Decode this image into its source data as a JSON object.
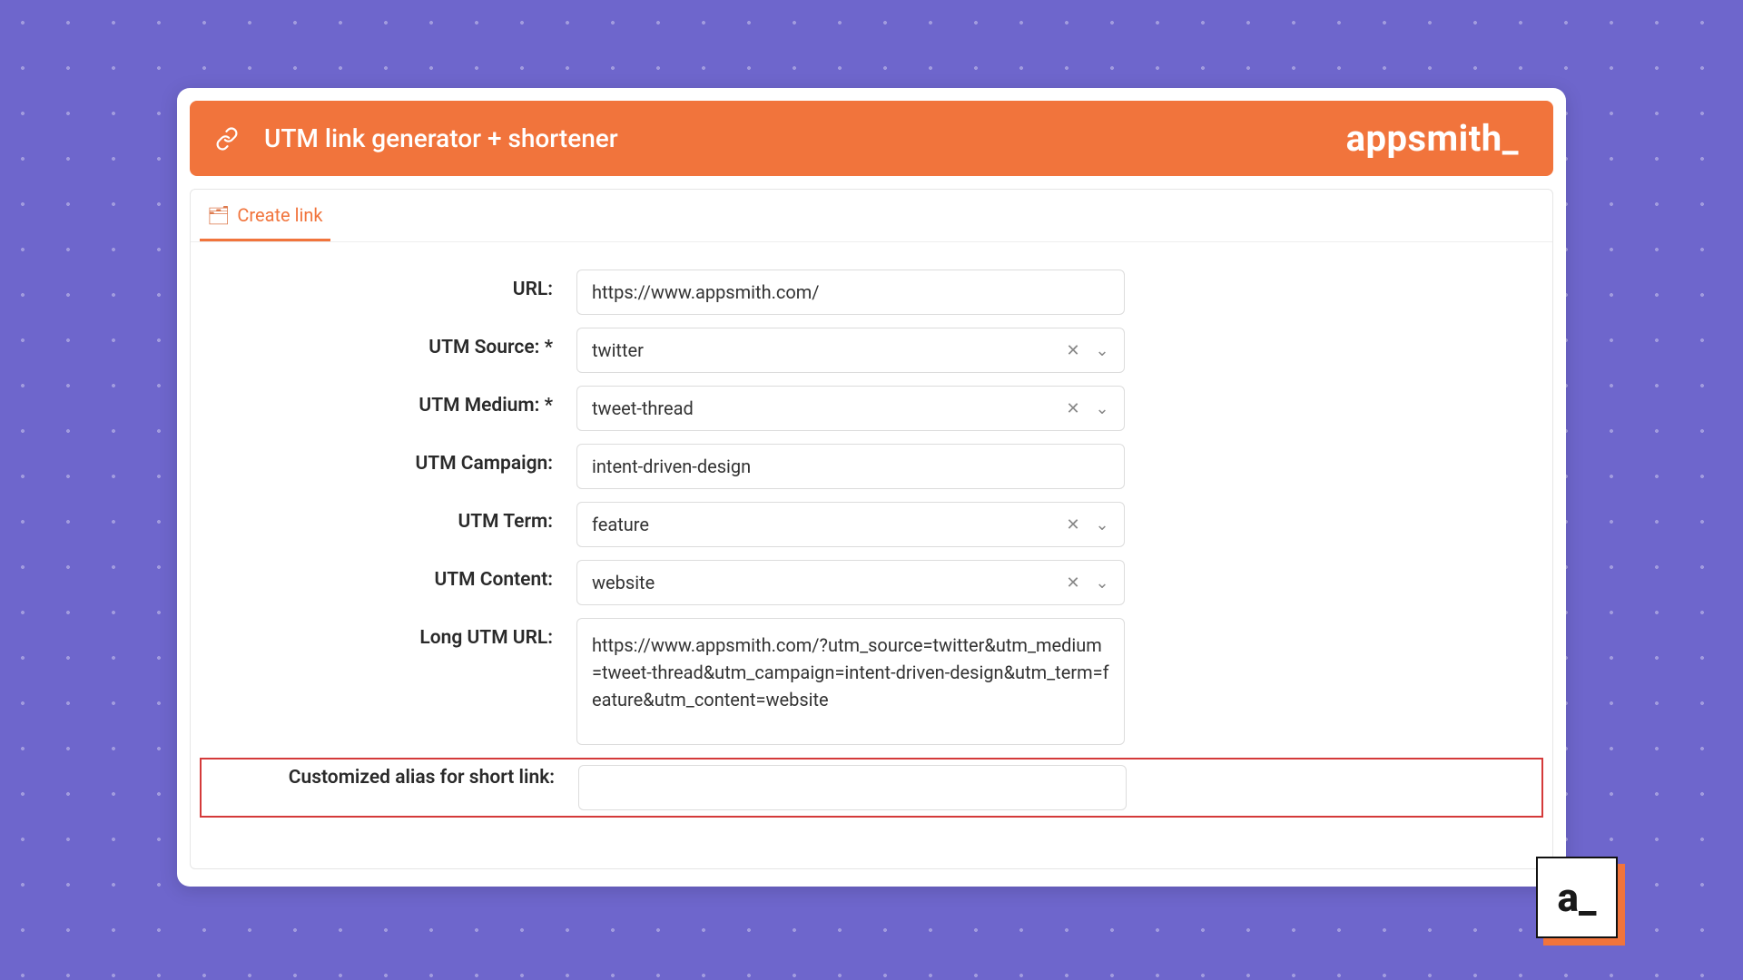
{
  "header": {
    "title": "UTM link generator + shortener",
    "brand": "appsmith_"
  },
  "tabs": {
    "create_link": {
      "icon": "🗂",
      "label": "Create link"
    }
  },
  "form": {
    "url": {
      "label": "URL:",
      "value": "https://www.appsmith.com/"
    },
    "utm_source": {
      "label": "UTM Source: *",
      "value": "twitter"
    },
    "utm_medium": {
      "label": "UTM Medium: *",
      "value": "tweet-thread"
    },
    "utm_campaign": {
      "label": "UTM Campaign:",
      "value": "intent-driven-design"
    },
    "utm_term": {
      "label": "UTM Term:",
      "value": "feature"
    },
    "utm_content": {
      "label": "UTM Content:",
      "value": "website"
    },
    "long_url": {
      "label": "Long UTM URL:",
      "value": "https://www.appsmith.com/?utm_source=twitter&utm_medium=tweet-thread&utm_campaign=intent-driven-design&utm_term=feature&utm_content=website"
    },
    "alias": {
      "label": "Customized alias for short link:",
      "value": ""
    }
  },
  "logo_chip": "a_"
}
